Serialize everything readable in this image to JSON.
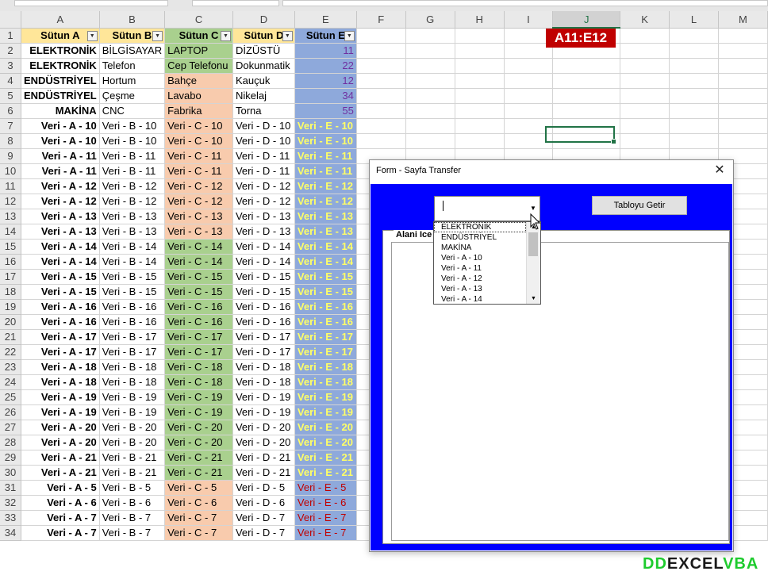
{
  "columns": [
    "A",
    "B",
    "C",
    "D",
    "E",
    "F",
    "G",
    "H",
    "I",
    "J",
    "K",
    "L",
    "M"
  ],
  "header": {
    "A": "Sütun A",
    "B": "Sütun B",
    "C": "Sütun C",
    "D": "Sütun D",
    "E": "Sütun E"
  },
  "rows": [
    {
      "n": "1"
    },
    {
      "n": "2",
      "a": "ELEKTRONİK",
      "b": "BİLGİSAYAR",
      "c": "LAPTOP",
      "d": "DİZÜSTÜ",
      "e": "11"
    },
    {
      "n": "3",
      "a": "ELEKTRONİK",
      "b": "Telefon",
      "c": "Cep Telefonu",
      "d": "Dokunmatik",
      "e": "22"
    },
    {
      "n": "4",
      "a": "ENDÜSTRİYEL",
      "b": "Hortum",
      "c": "Bahçe",
      "d": "Kauçuk",
      "e": "12"
    },
    {
      "n": "5",
      "a": "ENDÜSTRİYEL",
      "b": "Çeşme",
      "c": "Lavabo",
      "d": "Nikelaj",
      "e": "34"
    },
    {
      "n": "6",
      "a": "MAKİNA",
      "b": "CNC",
      "c": "Fabrika",
      "d": "Torna",
      "e": "55"
    },
    {
      "n": "7",
      "a": "Veri - A - 10",
      "b": "Veri - B - 10",
      "c": "Veri - C - 10",
      "d": "Veri - D - 10",
      "e": "Veri - E - 10"
    },
    {
      "n": "8",
      "a": "Veri - A - 10",
      "b": "Veri - B - 10",
      "c": "Veri - C - 10",
      "d": "Veri - D - 10",
      "e": "Veri - E - 10"
    },
    {
      "n": "9",
      "a": "Veri - A - 11",
      "b": "Veri - B - 11",
      "c": "Veri - C - 11",
      "d": "Veri - D - 11",
      "e": "Veri - E - 11"
    },
    {
      "n": "10",
      "a": "Veri - A - 11",
      "b": "Veri - B - 11",
      "c": "Veri - C - 11",
      "d": "Veri - D - 11",
      "e": "Veri - E - 11"
    },
    {
      "n": "11",
      "a": "Veri - A - 12",
      "b": "Veri - B - 12",
      "c": "Veri - C - 12",
      "d": "Veri - D - 12",
      "e": "Veri - E - 12"
    },
    {
      "n": "12",
      "a": "Veri - A - 12",
      "b": "Veri - B - 12",
      "c": "Veri - C - 12",
      "d": "Veri - D - 12",
      "e": "Veri - E - 12"
    },
    {
      "n": "13",
      "a": "Veri - A - 13",
      "b": "Veri - B - 13",
      "c": "Veri - C - 13",
      "d": "Veri - D - 13",
      "e": "Veri - E - 13"
    },
    {
      "n": "14",
      "a": "Veri - A - 13",
      "b": "Veri - B - 13",
      "c": "Veri - C - 13",
      "d": "Veri - D - 13",
      "e": "Veri - E - 13"
    },
    {
      "n": "15",
      "a": "Veri - A - 14",
      "b": "Veri - B - 14",
      "c": "Veri - C - 14",
      "d": "Veri - D - 14",
      "e": "Veri - E - 14"
    },
    {
      "n": "16",
      "a": "Veri - A - 14",
      "b": "Veri - B - 14",
      "c": "Veri - C - 14",
      "d": "Veri - D - 14",
      "e": "Veri - E - 14"
    },
    {
      "n": "17",
      "a": "Veri - A - 15",
      "b": "Veri - B - 15",
      "c": "Veri - C - 15",
      "d": "Veri - D - 15",
      "e": "Veri - E - 15"
    },
    {
      "n": "18",
      "a": "Veri - A - 15",
      "b": "Veri - B - 15",
      "c": "Veri - C - 15",
      "d": "Veri - D - 15",
      "e": "Veri - E - 15"
    },
    {
      "n": "19",
      "a": "Veri - A - 16",
      "b": "Veri - B - 16",
      "c": "Veri - C - 16",
      "d": "Veri - D - 16",
      "e": "Veri - E - 16"
    },
    {
      "n": "20",
      "a": "Veri - A - 16",
      "b": "Veri - B - 16",
      "c": "Veri - C - 16",
      "d": "Veri - D - 16",
      "e": "Veri - E - 16"
    },
    {
      "n": "21",
      "a": "Veri - A - 17",
      "b": "Veri - B - 17",
      "c": "Veri - C - 17",
      "d": "Veri - D - 17",
      "e": "Veri - E - 17"
    },
    {
      "n": "22",
      "a": "Veri - A - 17",
      "b": "Veri - B - 17",
      "c": "Veri - C - 17",
      "d": "Veri - D - 17",
      "e": "Veri - E - 17"
    },
    {
      "n": "23",
      "a": "Veri - A - 18",
      "b": "Veri - B - 18",
      "c": "Veri - C - 18",
      "d": "Veri - D - 18",
      "e": "Veri - E - 18"
    },
    {
      "n": "24",
      "a": "Veri - A - 18",
      "b": "Veri - B - 18",
      "c": "Veri - C - 18",
      "d": "Veri - D - 18",
      "e": "Veri - E - 18"
    },
    {
      "n": "25",
      "a": "Veri - A - 19",
      "b": "Veri - B - 19",
      "c": "Veri - C - 19",
      "d": "Veri - D - 19",
      "e": "Veri - E - 19"
    },
    {
      "n": "26",
      "a": "Veri - A - 19",
      "b": "Veri - B - 19",
      "c": "Veri - C - 19",
      "d": "Veri - D - 19",
      "e": "Veri - E - 19"
    },
    {
      "n": "27",
      "a": "Veri - A - 20",
      "b": "Veri - B - 20",
      "c": "Veri - C - 20",
      "d": "Veri - D - 20",
      "e": "Veri - E - 20"
    },
    {
      "n": "28",
      "a": "Veri - A - 20",
      "b": "Veri - B - 20",
      "c": "Veri - C - 20",
      "d": "Veri - D - 20",
      "e": "Veri - E - 20"
    },
    {
      "n": "29",
      "a": "Veri - A - 21",
      "b": "Veri - B - 21",
      "c": "Veri - C - 21",
      "d": "Veri - D - 21",
      "e": "Veri - E - 21"
    },
    {
      "n": "30",
      "a": "Veri - A - 21",
      "b": "Veri - B - 21",
      "c": "Veri - C - 21",
      "d": "Veri - D - 21",
      "e": "Veri - E - 21"
    },
    {
      "n": "31",
      "a": "Veri - A - 5",
      "b": "Veri - B - 5",
      "c": "Veri - C - 5",
      "d": "Veri - D - 5",
      "e": "Veri - E - 5"
    },
    {
      "n": "32",
      "a": "Veri - A - 6",
      "b": "Veri - B - 6",
      "c": "Veri - C - 6",
      "d": "Veri - D - 6",
      "e": "Veri - E - 6"
    },
    {
      "n": "33",
      "a": "Veri - A - 7",
      "b": "Veri - B - 7",
      "c": "Veri - C - 7",
      "d": "Veri - D - 7",
      "e": "Veri - E - 7"
    },
    {
      "n": "34",
      "a": "Veri - A - 7",
      "b": "Veri - B - 7",
      "c": "Veri - C - 7",
      "d": "Veri - D - 7",
      "e": "Veri - E - 7"
    }
  ],
  "colors": {
    "header_yellow": "#ffe699",
    "col_c_green": "#a9d08e",
    "col_c_orange": "#f8cbad",
    "col_e_blue": "#8ea9db",
    "number_purple": "#7030a0",
    "text_yellow": "#ffff66",
    "text_red": "#c00000",
    "dialog_blue": "#0000ff",
    "badge_red": "#c00000",
    "excel_green": "#217346"
  },
  "named_range_badge": "A11:E12",
  "form": {
    "title": "Form - Sayfa Transfer",
    "button_label": "Tabloyu Getir",
    "frame_label": "Alani Ice",
    "combo_value": "",
    "list_items": [
      "ELEKTRONİK",
      "ENDÜSTRİYEL",
      "MAKİNA",
      "Veri - A - 10",
      "Veri - A - 11",
      "Veri - A - 12",
      "Veri - A - 13",
      "Veri - A - 14"
    ]
  },
  "watermark": {
    "part1": "DD",
    "part2": "EXCEL",
    "part3": "VBA"
  }
}
